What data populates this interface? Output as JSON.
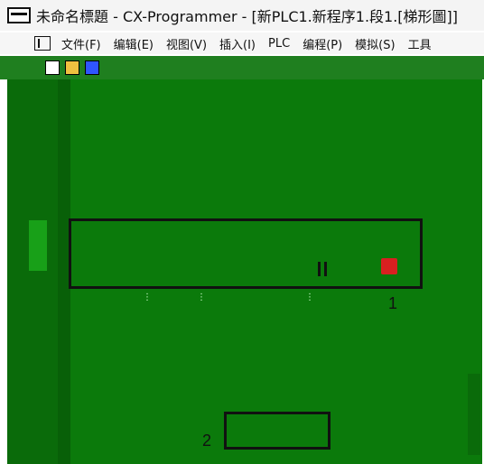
{
  "window": {
    "title": "未命名標題 - CX-Programmer - [新PLC1.新程序1.段1.[梯形圖]]"
  },
  "menu": {
    "items": [
      {
        "label": "文件(F)"
      },
      {
        "label": "编辑(E)"
      },
      {
        "label": "视图(V)"
      },
      {
        "label": "插入(I)"
      },
      {
        "label": "PLC"
      },
      {
        "label": "编程(P)"
      },
      {
        "label": "模拟(S)"
      },
      {
        "label": "工具"
      }
    ]
  },
  "callouts": {
    "first": "1",
    "second": "2"
  },
  "colors": {
    "workarea": "#0b7a0b",
    "toolbar": "#1f7f1f",
    "coil": "#d82020",
    "rung_border": "#111111"
  },
  "icons": {
    "app": "app-icon",
    "document": "document-icon",
    "new": "new-file-icon",
    "open": "open-folder-icon",
    "save": "save-icon"
  }
}
